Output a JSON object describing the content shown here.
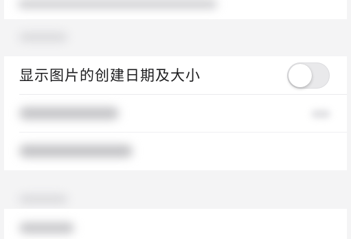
{
  "settings": {
    "show_image_date_size": {
      "label": "显示图片的创建日期及大小",
      "toggle_state": "off"
    }
  },
  "colors": {
    "background": "#f4f4f5",
    "card": "#ffffff",
    "toggle_off_track": "#e9e9eb",
    "text_primary": "#1c1c1e"
  }
}
